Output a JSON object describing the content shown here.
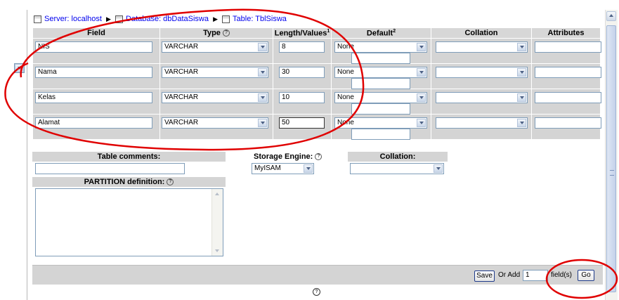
{
  "breadcrumb": {
    "server": "Server: localhost",
    "database": "Database: dbDataSiswa",
    "table": "Table: TblSiswa"
  },
  "table": {
    "headers": {
      "field": "Field",
      "type": "Type",
      "length": "Length/Values",
      "length_sup": "1",
      "default": "Default",
      "default_sup": "2",
      "collation": "Collation",
      "attributes": "Attributes"
    },
    "rows": [
      {
        "field": "NIS",
        "type": "VARCHAR",
        "length": "8",
        "default": "None"
      },
      {
        "field": "Nama",
        "type": "VARCHAR",
        "length": "30",
        "default": "None"
      },
      {
        "field": "Kelas",
        "type": "VARCHAR",
        "length": "10",
        "default": "None"
      },
      {
        "field": "Alamat",
        "type": "VARCHAR",
        "length": "50",
        "default": "None"
      }
    ]
  },
  "options": {
    "table_comments_label": "Table comments:",
    "storage_engine_label": "Storage Engine:",
    "storage_engine_value": "MyISAM",
    "collation_label": "Collation:",
    "partition_label": "PARTITION definition:"
  },
  "footer": {
    "save_label": "Save",
    "or_add_label": "Or Add",
    "add_count": "1",
    "fields_label": "field(s)",
    "go_label": "Go"
  },
  "colors": {
    "link": "#0000ee",
    "header_bg": "#d7d7d7",
    "row_bg": "#d4d4d4",
    "annotation": "#e00000"
  },
  "icons": [
    "server-icon",
    "database-icon",
    "table-icon",
    "help-icon",
    "chevron-down-icon"
  ]
}
